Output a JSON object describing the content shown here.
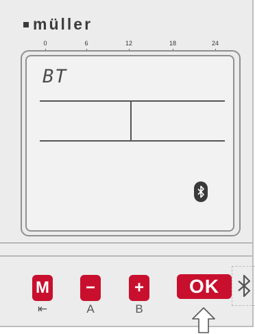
{
  "brand": {
    "name": "müller"
  },
  "scale": {
    "labels": [
      "0",
      "6",
      "12",
      "18",
      "24"
    ]
  },
  "lcd": {
    "text": "BT"
  },
  "keys": {
    "m": {
      "label": "M",
      "sublabel": "⇤"
    },
    "minus": {
      "label": "−",
      "sublabel": "A"
    },
    "plus": {
      "label": "+",
      "sublabel": "B"
    },
    "ok": {
      "label": "OK"
    }
  },
  "icons": [
    "bluetooth-icon",
    "hand-pointer-icon"
  ],
  "colors": {
    "key_red": "#c8102e",
    "panel": "#ececec"
  }
}
